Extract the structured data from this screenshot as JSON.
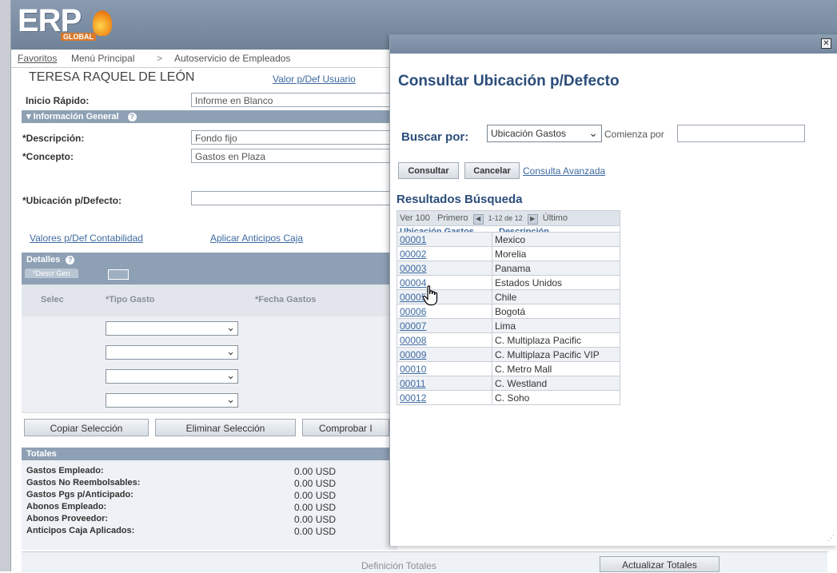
{
  "logo": {
    "main": "ERP",
    "sub": "GLOBAL"
  },
  "breadcrumb": [
    "Favoritos",
    "Menú Principal",
    ">",
    "Autoservicio de Empleados"
  ],
  "employee_name": "TERESA RAQUEL DE LEÓN",
  "user_default_link": "Valor p/Def Usuario",
  "quick_start": {
    "label": "Inicio Rápido:",
    "value": "Informe en Blanco"
  },
  "general_info": {
    "title": "Información General"
  },
  "fields": {
    "description": {
      "label": "*Descripción:",
      "value": "Fondo fijo"
    },
    "concept": {
      "label": "*Concepto:",
      "value": "Gastos en Plaza"
    },
    "default_location": {
      "label": "*Ubicación p/Defecto:",
      "value": ""
    }
  },
  "links": {
    "accounting_defaults": "Valores p/Def Contabilidad",
    "apply_advances": "Aplicar Anticipos Caja"
  },
  "details": {
    "title": "Detalles",
    "tab": "*Descr Gen",
    "columns": [
      "Selec",
      "*Tipo Gasto",
      "*Fecha Gastos"
    ],
    "row_count": 4
  },
  "buttons": {
    "copy": "Copiar Selección",
    "delete": "Eliminar Selección",
    "check": "Comprobar I",
    "update_totals": "Actualizar Totales"
  },
  "totals": {
    "title": "Totales",
    "rows": [
      {
        "label": "Gastos Empleado:",
        "value": "0.00 USD"
      },
      {
        "label": "Gastos No Reembolsables:",
        "value": "0.00 USD"
      },
      {
        "label": "Gastos Pgs p/Anticipado:",
        "value": "0.00 USD"
      },
      {
        "label": "Abonos Empleado:",
        "value": "0.00 USD"
      },
      {
        "label": "Abonos Proveedor:",
        "value": "0.00 USD"
      },
      {
        "label": "Anticipos Caja Aplicados:",
        "value": "0.00 USD"
      }
    ],
    "definition_link": "Definición Totales"
  },
  "modal": {
    "title": "Consultar Ubicación p/Defecto",
    "search_by_label": "Buscar por:",
    "search_by_value": "Ubicación Gastos",
    "begins_with_label": "Comienza por",
    "begins_with_value": "",
    "consult_button": "Consultar",
    "cancel_button": "Cancelar",
    "advanced_link": "Consulta Avanzada",
    "results_title": "Resultados Búsqueda",
    "pager": {
      "view": "Ver 100",
      "first": "Primero",
      "range": "1-12 de 12",
      "last": "Último"
    },
    "columns": [
      "Ubicación Gastos",
      "Descripción"
    ],
    "rows": [
      {
        "code": "00001",
        "desc": "Mexico"
      },
      {
        "code": "00002",
        "desc": "Morelia"
      },
      {
        "code": "00003",
        "desc": "Panama"
      },
      {
        "code": "00004",
        "desc": "Estados Unidos"
      },
      {
        "code": "00005",
        "desc": "Chile"
      },
      {
        "code": "00006",
        "desc": "Bogotá"
      },
      {
        "code": "00007",
        "desc": "Lima"
      },
      {
        "code": "00008",
        "desc": "C. Multiplaza Pacific"
      },
      {
        "code": "00009",
        "desc": "C. Multiplaza Pacific VIP"
      },
      {
        "code": "00010",
        "desc": "C. Metro Mall"
      },
      {
        "code": "00011",
        "desc": "C. Westland"
      },
      {
        "code": "00012",
        "desc": "C. Soho"
      }
    ]
  }
}
